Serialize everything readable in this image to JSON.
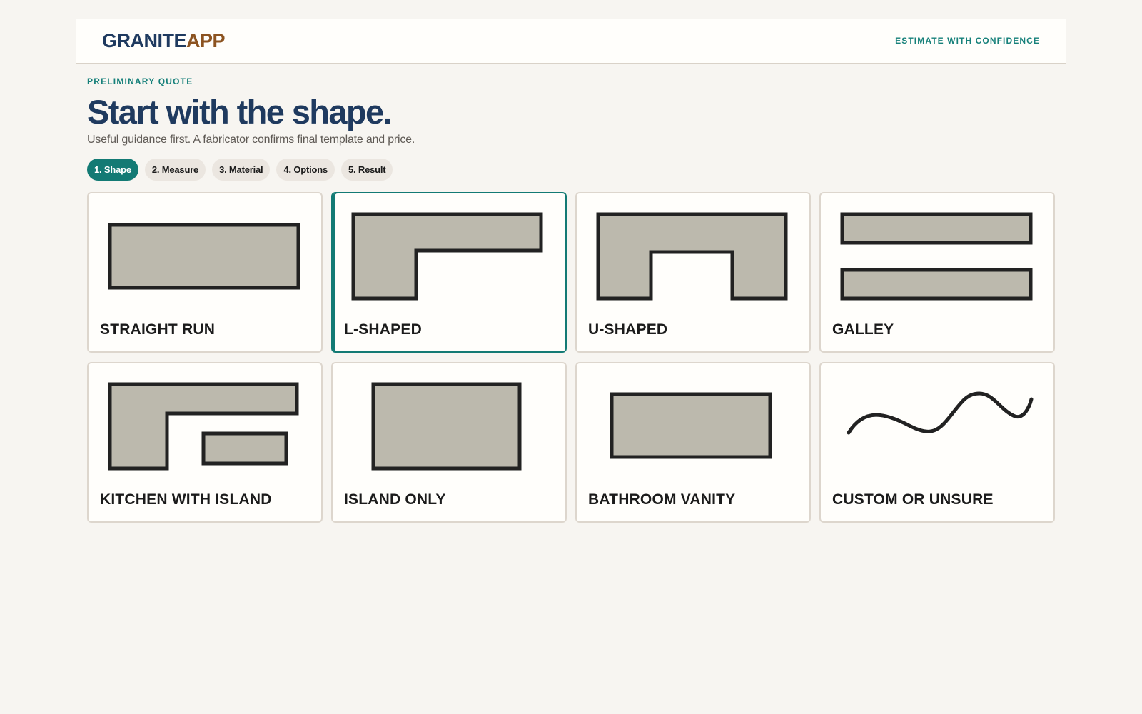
{
  "brand": {
    "part1": "GRANITE",
    "part2": "APP"
  },
  "header": {
    "tagline": "ESTIMATE WITH CONFIDENCE"
  },
  "page": {
    "eyebrow": "PRELIMINARY QUOTE",
    "title": "Start with the shape.",
    "subtitle": "Useful guidance first. A fabricator confirms final template and price."
  },
  "steps": [
    {
      "label": "1. Shape",
      "active": true
    },
    {
      "label": "2. Measure",
      "active": false
    },
    {
      "label": "3. Material",
      "active": false
    },
    {
      "label": "4. Options",
      "active": false
    },
    {
      "label": "5. Result",
      "active": false
    }
  ],
  "shapes": [
    {
      "label": "STRAIGHT RUN",
      "icon": "straight-run-shape-icon",
      "selected": false
    },
    {
      "label": "L-SHAPED",
      "icon": "l-shaped-shape-icon",
      "selected": true
    },
    {
      "label": "U-SHAPED",
      "icon": "u-shaped-shape-icon",
      "selected": false
    },
    {
      "label": "GALLEY",
      "icon": "galley-shape-icon",
      "selected": false
    },
    {
      "label": "KITCHEN WITH ISLAND",
      "icon": "kitchen-with-island-shape-icon",
      "selected": false
    },
    {
      "label": "ISLAND ONLY",
      "icon": "island-only-shape-icon",
      "selected": false
    },
    {
      "label": "BATHROOM VANITY",
      "icon": "bathroom-vanity-shape-icon",
      "selected": false
    },
    {
      "label": "CUSTOM OR UNSURE",
      "icon": "custom-squiggle-icon",
      "selected": false
    }
  ],
  "colors": {
    "accent": "#137a74",
    "brand_navy": "#1f3a5f",
    "brand_brown": "#8c5320",
    "shape_fill": "#bcb9ad",
    "shape_stroke": "#222222"
  }
}
